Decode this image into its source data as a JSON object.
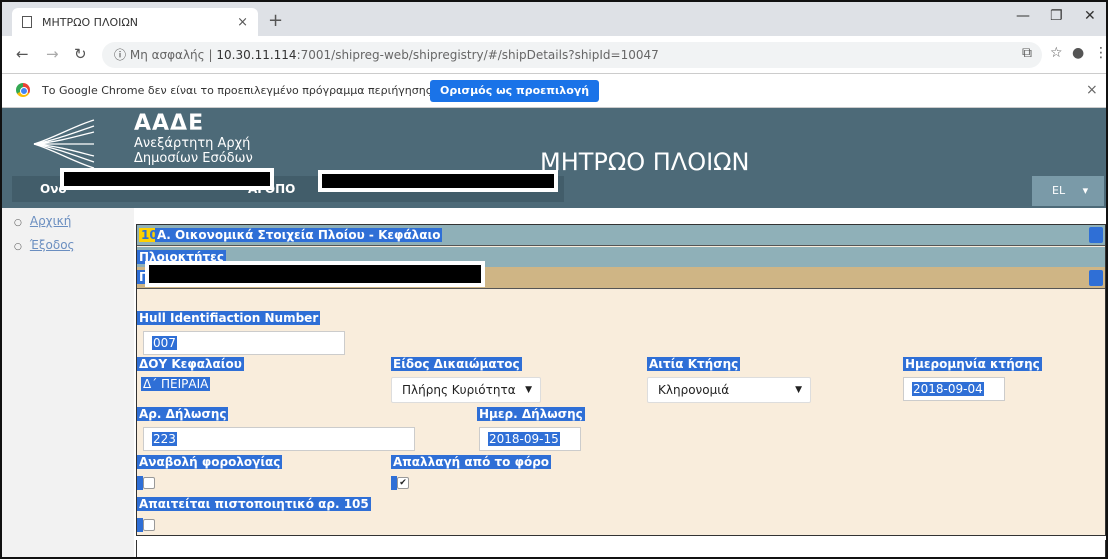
{
  "browser": {
    "tab_title": "ΜΗΤΡΩΟ ΠΛΟΙΩΝ",
    "tab_close": "×",
    "new_tab": "+",
    "url_security": "Μη ασφαλής",
    "url_host": "10.30.11.114",
    "url_path": ":7001/shipreg-web/shipregistry/#/shipDetails?shipId=10047",
    "infobar_message": "Το Google Chrome δεν είναι το προεπιλεγμένο πρόγραμμα περιήγησης",
    "infobar_button": "Ορισμός ως προεπιλογή",
    "infobar_close": "×"
  },
  "site": {
    "brand_short": "ΑΑΔΕ",
    "brand_line1": "Ανεξάρτητη Αρχή",
    "brand_line2": "Δημοσίων Εσόδων",
    "title": "ΜΗΤΡΩΟ ΠΛΟΙΩΝ",
    "user_prefix": "Ονο",
    "user_mid": "ΑΓΟΠΟ",
    "language": "EL",
    "language_arrow": "▾"
  },
  "sidebar": {
    "items": [
      {
        "label": "Αρχική"
      },
      {
        "label": "Έξοδος"
      }
    ]
  },
  "form": {
    "section_number": "10",
    "section_title": "Α. Οικονομικά Στοιχεία Πλοίου - Κεφάλαιο",
    "owners_title": "Πλοιοκτήτες",
    "owners_letter": "Π",
    "hull_label": "Hull Identifiaction Number",
    "hull_value": "007",
    "doy_label": "ΔΟΥ Κεφαλαίου",
    "doy_value": "Δ΄ ΠΕΙΡΑΙΑ",
    "right_type_label": "Είδος Δικαιώματος",
    "right_type_value": "Πλήρης Κυριότητα",
    "acquisition_cause_label": "Αιτία Κτήσης",
    "acquisition_cause_value": "Κληρονομιά",
    "acquisition_date_label": "Ημερομηνία κτήσης",
    "acquisition_date_value": "2018-09-04",
    "declaration_no_label": "Αρ. Δήλωσης",
    "declaration_no_value": "223",
    "declaration_date_label": "Ημερ. Δήλωσης",
    "declaration_date_value": "2018-09-15",
    "tax_deferral_label": "Αναβολή φορολογίας",
    "tax_deferral_checked": false,
    "tax_exemption_label": "Απαλλαγή από το φόρο",
    "tax_exemption_checked": true,
    "certificate_label": "Απαιτείται πιστοποιητικό αρ. 105",
    "certificate_checked": false,
    "check_mark": "✔"
  }
}
